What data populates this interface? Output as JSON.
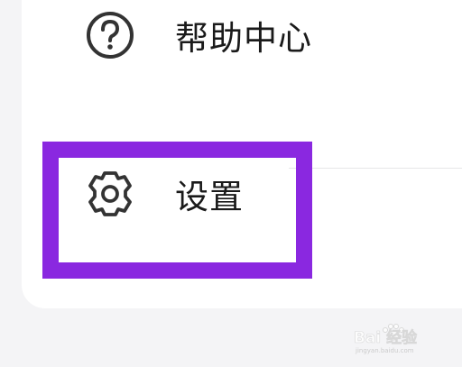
{
  "menu": {
    "items": [
      {
        "label": "帮助中心",
        "icon": "help-circle-icon"
      },
      {
        "label": "设置",
        "icon": "gear-icon"
      }
    ]
  },
  "highlight": {
    "color": "#8a28e0"
  },
  "watermark": {
    "text": "Bai 经验",
    "subtext": "jingyan.baidu.com"
  }
}
